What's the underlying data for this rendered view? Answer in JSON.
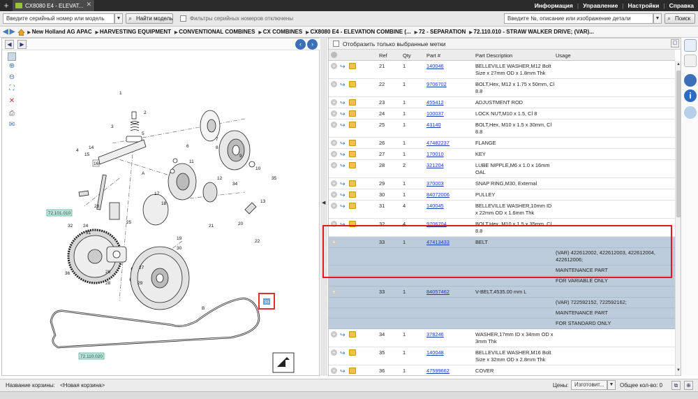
{
  "window": {
    "tab_title": "CX8080 E4 - ELEVAT...",
    "new_tab": "+",
    "close_tab": "✕"
  },
  "top_menu": [
    "Информация",
    "Управление",
    "Настройки",
    "Справка"
  ],
  "search": {
    "serial_placeholder": "Введите серийный номер или модель",
    "find_model_label": "Найти модель",
    "serial_filter_label": "Фильтры серийных номеров отключены",
    "part_search_placeholder": "Введите №, описание или изображение детали",
    "search_label": "Поиск"
  },
  "breadcrumb": [
    "New Holland AG APAC",
    "HARVESTING EQUIPMENT",
    "CONVENTIONAL COMBINES",
    "CX COMBINES",
    "CX8080 E4 - ELEVATION COMBINE (...",
    "72 - SEPARATION",
    "72.110.010 - STRAW WALKER DRIVE; (VAR)..."
  ],
  "parts_toolbar": {
    "show_selected_label": "Отобразить только выбранные метки"
  },
  "table": {
    "headers": [
      "Ref",
      "Qty",
      "Part #",
      "Part Description",
      "Usage"
    ],
    "rows": [
      {
        "ref": "21",
        "qty": "1",
        "part": "140046",
        "desc": "BELLEVILLE WASHER,M12 Bolt Size x 27mm OD x 1.8mm Thk",
        "usage": ""
      },
      {
        "ref": "22",
        "qty": "1",
        "part": "9706702",
        "desc": "BOLT,Hex, M12 x 1.75 x 50mm, Cl 8.8",
        "usage": ""
      },
      {
        "ref": "23",
        "qty": "1",
        "part": "455412",
        "desc": "ADJUSTMENT ROD",
        "usage": ""
      },
      {
        "ref": "24",
        "qty": "1",
        "part": "100037",
        "desc": "LOCK NUT,M10 x 1.5, Cl 8",
        "usage": ""
      },
      {
        "ref": "25",
        "qty": "1",
        "part": "43140",
        "desc": "BOLT,Hex, M10 x 1.5 x 30mm, Cl 8.8",
        "usage": ""
      },
      {
        "ref": "26",
        "qty": "1",
        "part": "47482237",
        "desc": "FLANGE",
        "usage": ""
      },
      {
        "ref": "27",
        "qty": "1",
        "part": "170010",
        "desc": "KEY",
        "usage": ""
      },
      {
        "ref": "28",
        "qty": "2",
        "part": "321204",
        "desc": "LUBE NIPPLE,M6 x 1.0 x 16mm OAL",
        "usage": ""
      },
      {
        "ref": "29",
        "qty": "1",
        "part": "370003",
        "desc": "SNAP RING,M30, External",
        "usage": ""
      },
      {
        "ref": "30",
        "qty": "1",
        "part": "84072006",
        "desc": "PULLEY",
        "usage": ""
      },
      {
        "ref": "31",
        "qty": "4",
        "part": "140045",
        "desc": "BELLEVILLE WASHER,10mm ID x 22mm OD x 1.6mm Thk",
        "usage": ""
      },
      {
        "ref": "32",
        "qty": "4",
        "part": "9706704",
        "desc": "BOLT,Hex, M10 x 1.5 x 35mm, Cl 8.8",
        "usage": ""
      },
      {
        "ref": "33",
        "qty": "1",
        "part": "47413433",
        "desc": "BELT",
        "usage": "",
        "selected": true,
        "sub": [
          "(VAR) 422612002, 422612003, 422612004, 422612006;",
          "MAINTENANCE PART",
          "FOR VARIABLE ONLY"
        ]
      },
      {
        "ref": "33",
        "qty": "1",
        "part": "84057462",
        "desc": "V-BELT,4535.00 mm L",
        "usage": "",
        "selected": true,
        "sub": [
          "(VAR) 722592152, 722592162;",
          "MAINTENANCE PART",
          "FOR STANDARD ONLY"
        ]
      },
      {
        "ref": "34",
        "qty": "1",
        "part": "378246",
        "desc": "WASHER,17mm ID x 34mm OD x 3mm Thk",
        "usage": ""
      },
      {
        "ref": "35",
        "qty": "1",
        "part": "140048",
        "desc": "BELLEVILLE WASHER,M16 Bolt Size x 32mm OD x 2.8mm Thk",
        "usage": ""
      },
      {
        "ref": "36",
        "qty": "1",
        "part": "47599662",
        "desc": "COVER",
        "usage": ""
      }
    ]
  },
  "diagram": {
    "callouts": [
      "1",
      "2",
      "3",
      "4",
      "5",
      "6",
      "7",
      "8",
      "9",
      "10",
      "11",
      "12",
      "13",
      "14",
      "15",
      "16",
      "17",
      "18",
      "19",
      "20",
      "21",
      "22",
      "23",
      "24",
      "25",
      "26",
      "27",
      "28",
      "29",
      "30",
      "31",
      "32",
      "33",
      "34",
      "35",
      "36",
      "A",
      "B"
    ],
    "refs": [
      "72.101.010",
      "72.110.020"
    ],
    "selected_callout": "33"
  },
  "bottom": {
    "basket_label": "Название корзины:",
    "basket_value": "<Новая корзина>",
    "prices_label": "Цены:",
    "prices_value": "Изготовит...",
    "total_label": "Общее кол-во: 0"
  },
  "icons": {
    "home": "home-icon",
    "search": "magnifier-icon",
    "info": "info-icon"
  }
}
